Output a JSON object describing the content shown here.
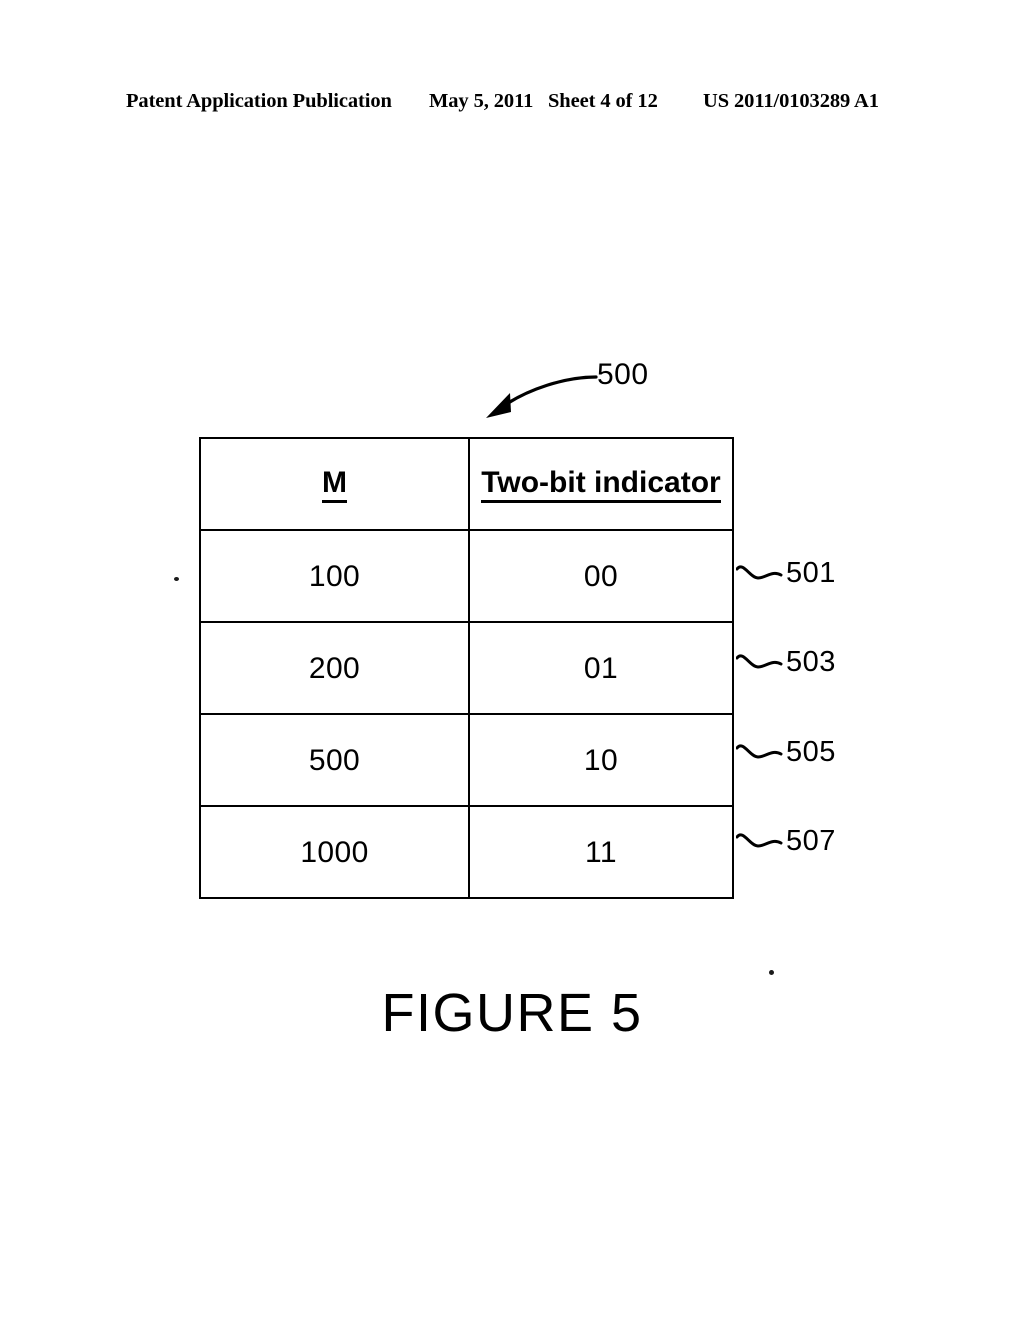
{
  "page_header": {
    "publication": "Patent Application Publication",
    "date": "May 5, 2011",
    "sheet": "Sheet 4 of 12",
    "doc_id": "US 2011/0103289 A1"
  },
  "figure": {
    "caption": "FIGURE 5",
    "callout_label": "500",
    "callout_icon": "curved-arrow-icon"
  },
  "table": {
    "headers": [
      "M",
      "Two-bit indicator"
    ],
    "rows": [
      {
        "m": "100",
        "indicator": "00",
        "ref": "501"
      },
      {
        "m": "200",
        "indicator": "01",
        "ref": "503"
      },
      {
        "m": "500",
        "indicator": "10",
        "ref": "505"
      },
      {
        "m": "1000",
        "indicator": "11",
        "ref": "507"
      }
    ]
  },
  "colors": {
    "ink": "#000000",
    "paper": "#ffffff"
  }
}
